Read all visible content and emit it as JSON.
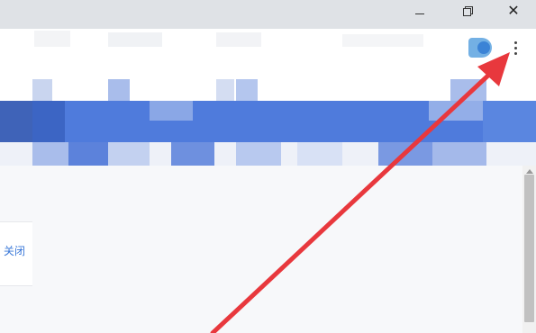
{
  "window": {
    "controls": {
      "minimize_icon": "minimize-icon",
      "restore_icon": "restore-icon",
      "close_icon": "close-icon",
      "close_glyph": "✕"
    }
  },
  "toolbar": {
    "menu_icon": "more-vertical-icon",
    "profile_icon": "profile-avatar-icon"
  },
  "content": {
    "close_label": "关闭"
  },
  "colors": {
    "accent_blue": "#4f7bdc",
    "arrow_red": "#e8383d",
    "link_blue": "#3a78d8"
  }
}
